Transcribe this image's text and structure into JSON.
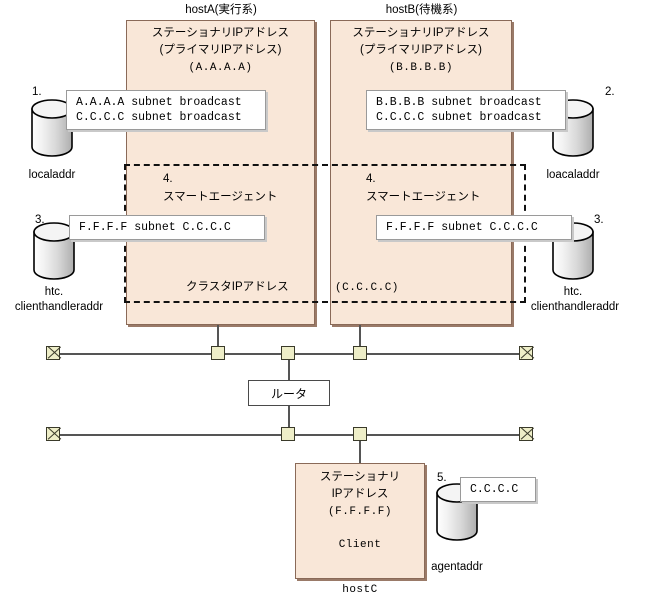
{
  "diagram": {
    "title": "Cluster stationary IP address configuration diagram",
    "colors": {
      "host_fill": "#f9e7d8",
      "host_border": "#8a6a58",
      "node_fill": "#eeeec8",
      "node_border": "#3a3a2a",
      "callout_bg": "#ffffff"
    }
  },
  "hostA": {
    "caption": "hostA(実行系)",
    "line1": "ステーショナリIPアドレス",
    "line2": "(プライマリIPアドレス)",
    "line3": "(A.A.A.A)",
    "agent_num": "4.",
    "agent_label": "スマートエージェント",
    "cluster_label": "クラスタIPアドレス"
  },
  "hostB": {
    "caption": "hostB(待機系)",
    "line1": "ステーショナリIPアドレス",
    "line2": "(プライマリIPアドレス)",
    "line3": "(B.B.B.B)",
    "agent_num": "4.",
    "agent_label": "スマートエージェント",
    "cluster_value": "(C.C.C.C)"
  },
  "hostC": {
    "caption": "hostC",
    "line1": "ステーショナリ",
    "line2": "IPアドレス",
    "line3": "(F.F.F.F)",
    "line4": "Client"
  },
  "callouts": {
    "a_localaddr_l1": "A.A.A.A subnet broadcast",
    "a_localaddr_l2": "C.C.C.C subnet broadcast",
    "b_localaddr_l1": "B.B.B.B subnet broadcast",
    "b_localaddr_l2": "C.C.C.C subnet broadcast",
    "a_handler": "F.F.F.F subnet C.C.C.C",
    "b_handler": "F.F.F.F subnet C.C.C.C",
    "agent": "C.C.C.C"
  },
  "cylinders": [
    {
      "num": "1.",
      "label_l1": "localaddr",
      "label_l2": ""
    },
    {
      "num": "2.",
      "label_l1": "loacaladdr",
      "label_l2": ""
    },
    {
      "num": "3.",
      "label_l1": "htc.",
      "label_l2": "clienthandleraddr"
    },
    {
      "num": "3.",
      "label_l1": "htc.",
      "label_l2": "clienthandleraddr"
    },
    {
      "num": "5.",
      "label_l1": "agentaddr",
      "label_l2": ""
    }
  ],
  "router": {
    "label": "ルータ"
  }
}
